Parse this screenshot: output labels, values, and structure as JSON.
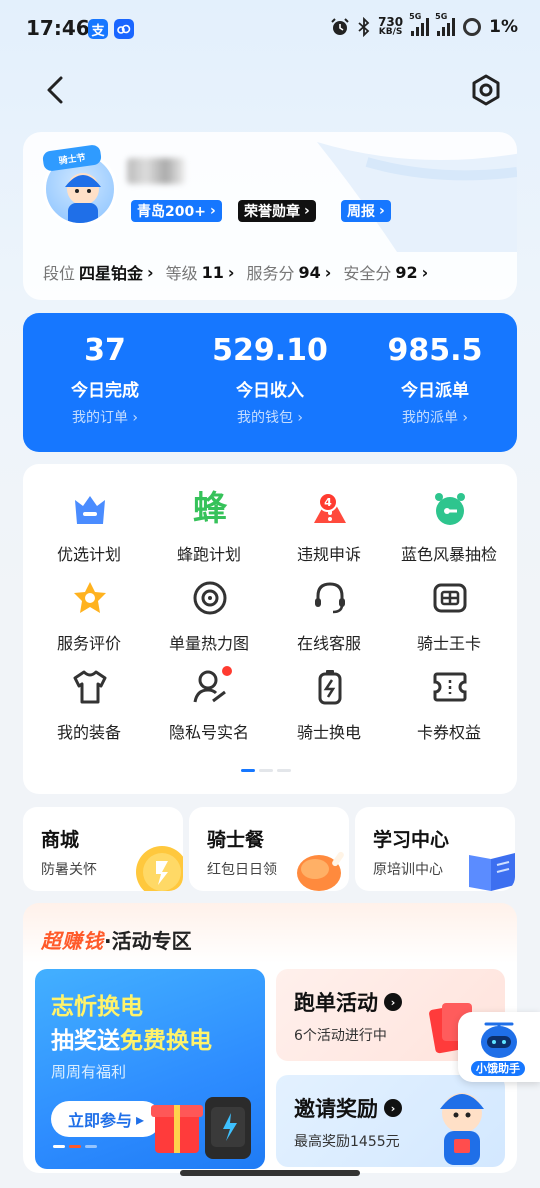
{
  "status": {
    "time": "17:46",
    "alipay_badge": "支",
    "speed_top": "730",
    "speed_bottom": "KB/S",
    "net_5g": "5G",
    "battery": "1%"
  },
  "profile": {
    "tags": [
      "青岛200+",
      "荣誉勋章",
      "周报"
    ],
    "rank_label": "段位",
    "rank_value": "四星铂金",
    "level_label": "等级",
    "level_value": "11",
    "service_label": "服务分",
    "service_value": "94",
    "safety_label": "安全分",
    "safety_value": "92",
    "avatar_banner": "骑士节"
  },
  "stats": [
    {
      "num": "37",
      "label": "今日完成",
      "sub": "我的订单"
    },
    {
      "num": "529.10",
      "label": "今日收入",
      "sub": "我的钱包"
    },
    {
      "num": "985.5",
      "label": "今日派单",
      "sub": "我的派单"
    }
  ],
  "grid": [
    {
      "label": "优选计划",
      "icon": "crown-icon"
    },
    {
      "label": "蜂跑计划",
      "icon": "bee-glyph-icon",
      "glyph": "蜂"
    },
    {
      "label": "违规申诉",
      "icon": "warning-icon",
      "badge": "4"
    },
    {
      "label": "蓝色风暴抽检",
      "icon": "alarm-clock-icon"
    },
    {
      "label": "服务评价",
      "icon": "star-badge-icon"
    },
    {
      "label": "单量热力图",
      "icon": "target-icon"
    },
    {
      "label": "在线客服",
      "icon": "headset-icon"
    },
    {
      "label": "骑士王卡",
      "icon": "card-icon"
    },
    {
      "label": "我的装备",
      "icon": "tshirt-icon"
    },
    {
      "label": "隐私号实名",
      "icon": "user-verify-icon"
    },
    {
      "label": "骑士换电",
      "icon": "battery-swap-icon"
    },
    {
      "label": "卡券权益",
      "icon": "coupon-icon"
    }
  ],
  "mini_cards": [
    {
      "title": "商城",
      "sub": "防暑关怀"
    },
    {
      "title": "骑士餐",
      "sub": "红包日日领"
    },
    {
      "title": "学习中心",
      "sub": "原培训中心"
    }
  ],
  "activity": {
    "title_hot": "超赚钱",
    "title_rest": "·活动专区",
    "banner_line1": "志忻换电",
    "banner_line2_a": "抽奖送",
    "banner_line2_b": "免费换电",
    "banner_line3": "周周有福利",
    "banner_cta": "立即参与",
    "card1_title": "跑单活动",
    "card1_sub": "6个活动进行中",
    "card2_title": "邀请奖励",
    "card2_sub": "最高奖励1455元"
  },
  "assistant": {
    "label": "小饿助手"
  },
  "colors": {
    "primary": "#1677ff",
    "hot": "#ff5a2a",
    "badge": "#ff3b30"
  }
}
